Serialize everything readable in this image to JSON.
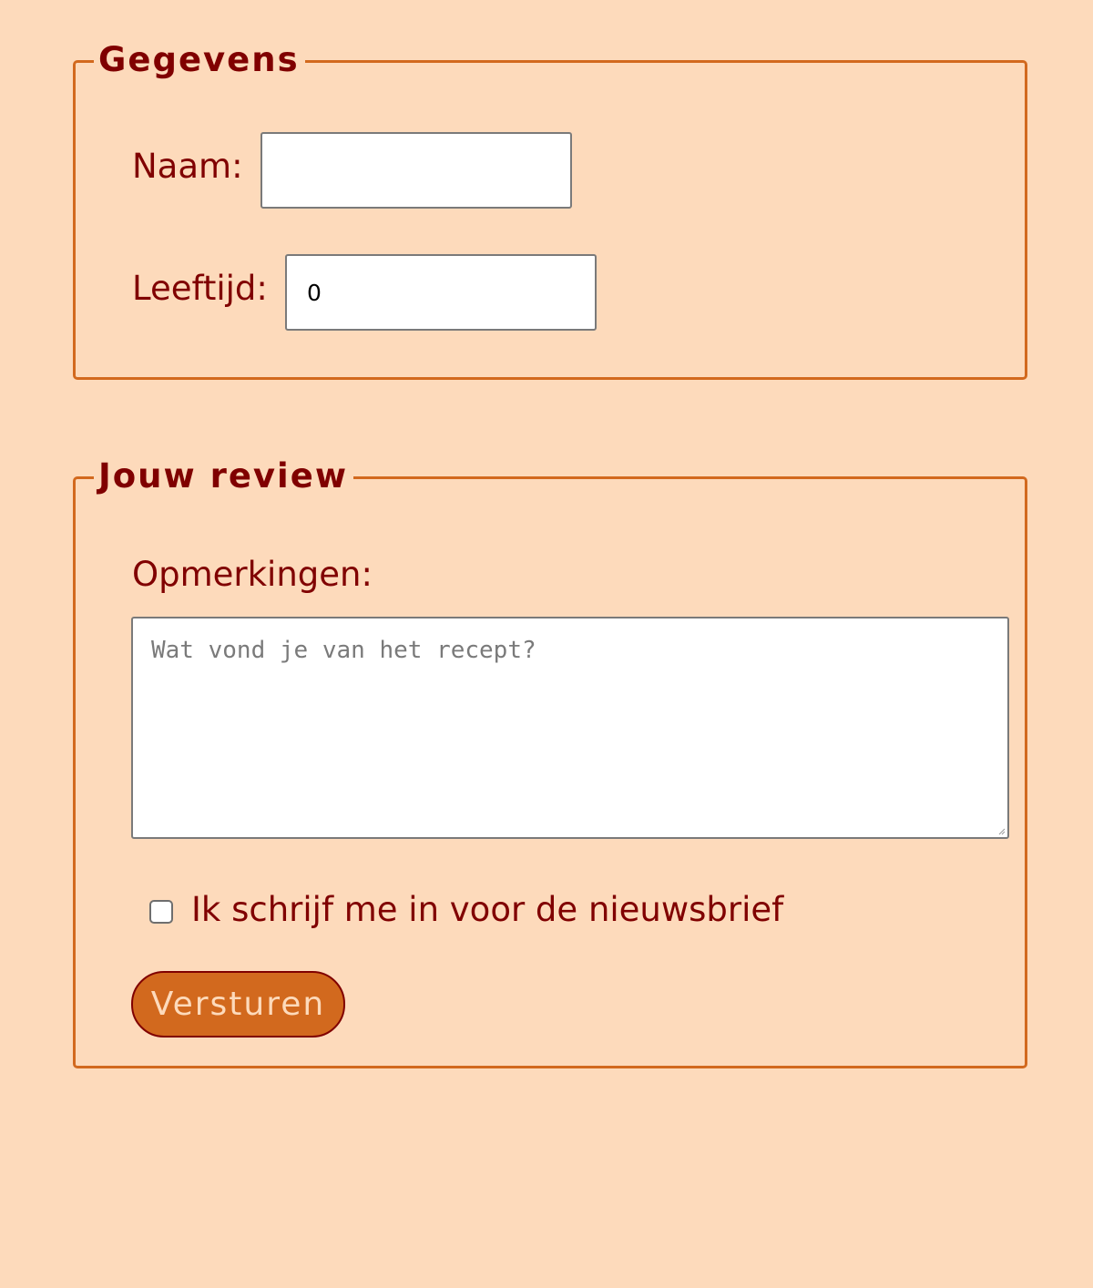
{
  "gegevens": {
    "legend": "Gegevens",
    "naam_label": "Naam:",
    "naam_value": "",
    "leeftijd_label": "Leeftijd:",
    "leeftijd_value": "0"
  },
  "review": {
    "legend": "Jouw review",
    "opmerkingen_label": "Opmerkingen:",
    "opmerkingen_placeholder": "Wat vond je van het recept?",
    "newsletter_label": "Ik schrijf me in voor de nieuwsbrief",
    "newsletter_checked": false,
    "submit_label": "Versturen"
  },
  "colors": {
    "background": "#FDDABB",
    "accent": "#D2691E",
    "text": "#800000"
  }
}
